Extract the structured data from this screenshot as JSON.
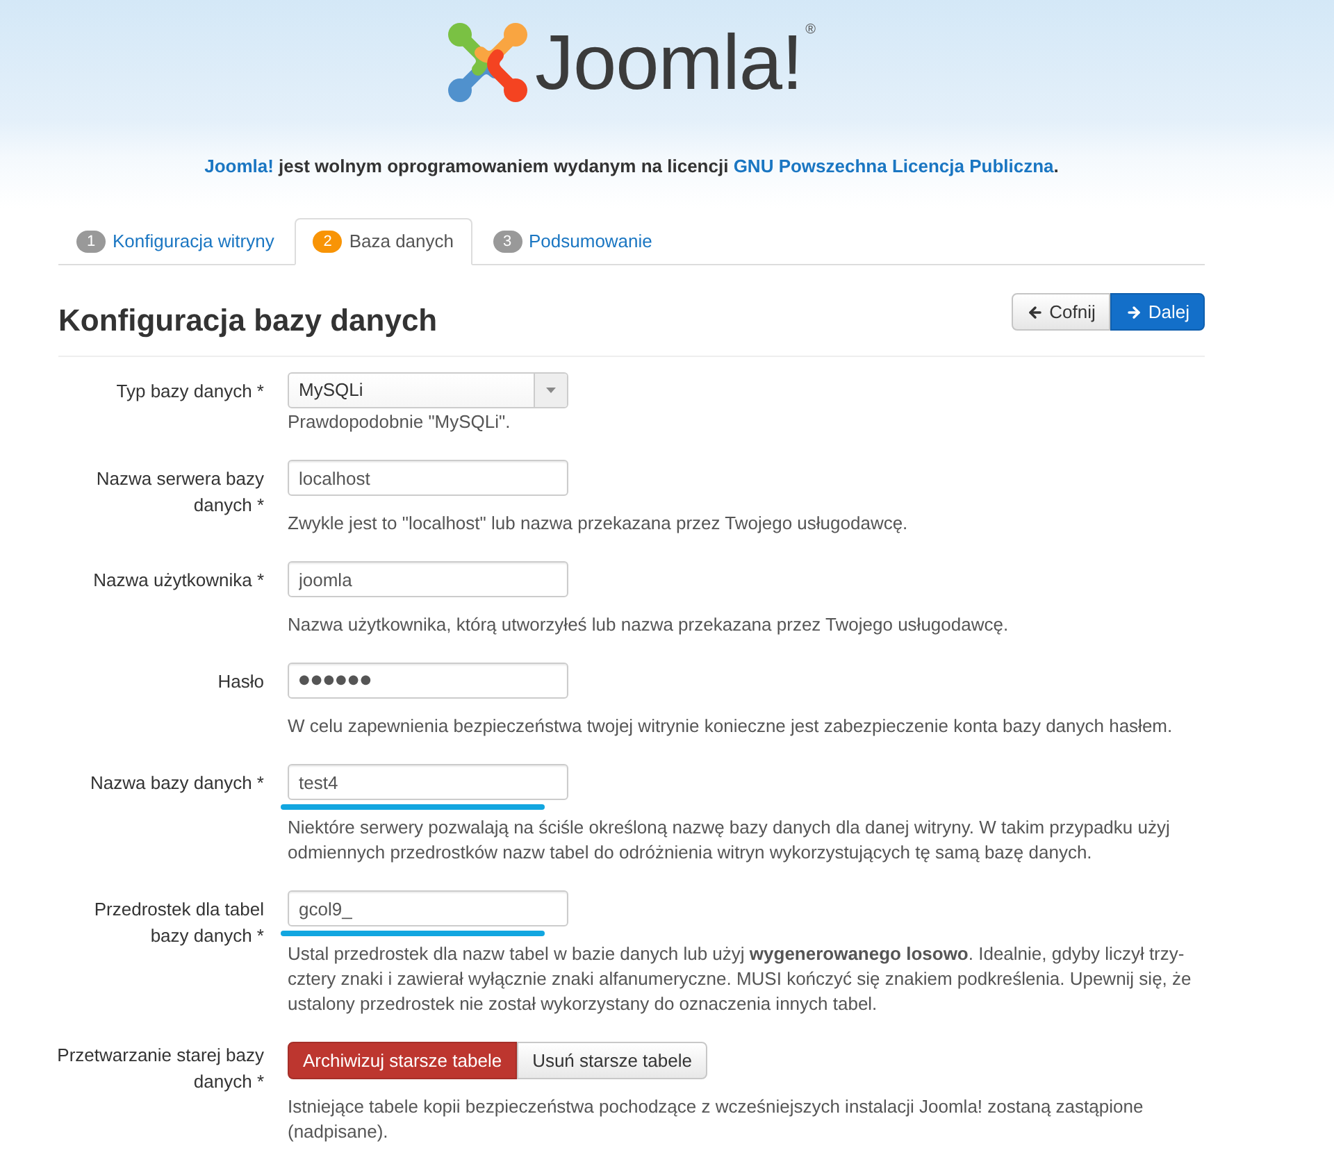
{
  "header": {
    "logo_text": "Joomla!",
    "registered_mark": "®"
  },
  "license_notice": [
    {
      "text": "Joomla!",
      "kind": "link"
    },
    {
      "text": " jest wolnym oprogramowaniem wydanym na licencji ",
      "kind": "plain"
    },
    {
      "text": "GNU Powszechna Licencja Publiczna",
      "kind": "link"
    },
    {
      "text": ".",
      "kind": "plain"
    }
  ],
  "tabs": [
    {
      "number": "1",
      "label": "Konfiguracja witryny",
      "selected": false
    },
    {
      "number": "2",
      "label": "Baza danych",
      "selected": true
    },
    {
      "number": "3",
      "label": "Podsumowanie",
      "selected": false
    }
  ],
  "page_title": "Konfiguracja bazy danych",
  "nav_buttons": [
    {
      "label": "Cofnij",
      "kind": "back"
    },
    {
      "label": "Dalej",
      "kind": "next"
    }
  ],
  "fields": [
    {
      "kind": "select",
      "label": "Typ bazy danych *",
      "value": "MySQLi",
      "help": "Prawdopodobnie \"MySQLi\"."
    },
    {
      "kind": "text",
      "label": "Nazwa serwera bazy danych *",
      "value": "localhost",
      "underlined": false,
      "help": "Zwykle jest to \"localhost\" lub nazwa przekazana przez Twojego usługodawcę."
    },
    {
      "kind": "text",
      "label": "Nazwa użytkownika *",
      "value": "joomla",
      "underlined": false,
      "help": "Nazwa użytkownika, którą utworzyłeś lub nazwa przekazana przez Twojego usługodawcę."
    },
    {
      "kind": "password",
      "label": "Hasło",
      "value": "●●●●●●",
      "underlined": false,
      "help": "W celu zapewnienia bezpieczeństwa twojej witrynie konieczne jest zabezpieczenie konta bazy danych hasłem."
    },
    {
      "kind": "text",
      "label": "Nazwa bazy danych *",
      "value": "test4",
      "underlined": true,
      "help": "Niektóre serwery pozwalają na ściśle określoną nazwę bazy danych dla danej witryny. W takim przypadku użyj odmiennych przedrostków nazw tabel do odróżnienia witryn wykorzystujących tę samą bazę danych."
    },
    {
      "kind": "text",
      "label": "Przedrostek dla tabel bazy danych *",
      "value": "gcol9_",
      "underlined": true,
      "help": "Ustal przedrostek dla nazw tabel w bazie danych lub użyj **wygenerowanego losowo**. Idealnie, gdyby liczył trzy-cztery znaki i zawierał wyłącznie znaki alfanumeryczne. MUSI kończyć się znakiem podkreślenia. Upewnij się, że ustalony przedrostek nie został wykorzystany do oznaczenia innych tabel."
    },
    {
      "kind": "toggle",
      "label": "Przetwarzanie starej bazy danych *",
      "options": [
        {
          "label": "Archiwizuj starsze tabele",
          "selected": true
        },
        {
          "label": "Usuń starsze tabele",
          "selected": false
        }
      ],
      "help": "Istniejące tabele kopii bezpieczeństwa pochodzące z wcześniejszych instalacji Joomla! zostaną zastąpione (nadpisane)."
    }
  ]
}
